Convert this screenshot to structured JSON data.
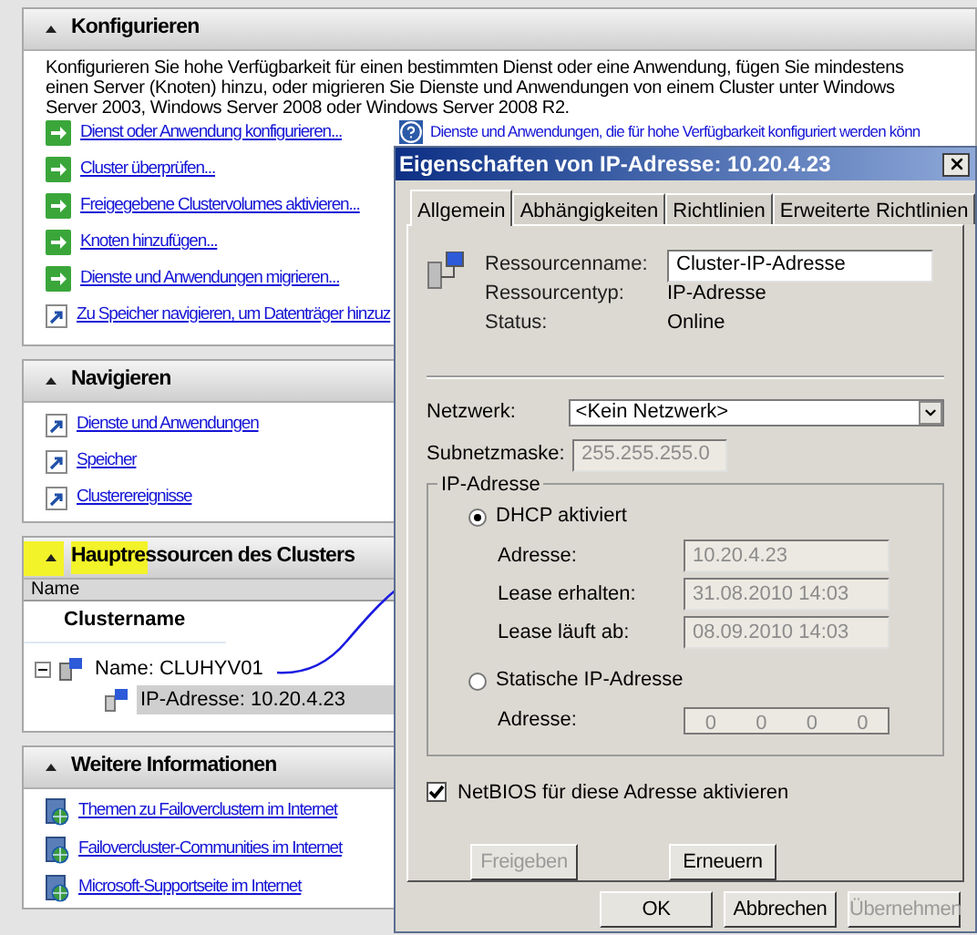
{
  "configure": {
    "title": "Konfigurieren",
    "expanded": true,
    "description": "Konfigurieren Sie hohe Verfügbarkeit für einen bestimmten Dienst oder eine Anwendung, fügen Sie mindestens einen Server (Knoten) hinzu, oder migrieren Sie Dienste und Anwendungen von einem Cluster unter Windows Server 2003, Windows Server 2008 oder Windows Server 2008 R2.",
    "links": [
      {
        "text": "Dienst oder Anwendung konfigurieren...",
        "kind": "wizard"
      },
      {
        "text": "Cluster überprüfen...",
        "kind": "wizard"
      },
      {
        "text": "Freigegebene Clustervolumes aktivieren...",
        "kind": "wizard"
      },
      {
        "text": "Knoten hinzufügen...",
        "kind": "wizard"
      },
      {
        "text": "Dienste und Anwendungen migrieren...",
        "kind": "wizard"
      },
      {
        "text": "Zu Speicher navigieren, um Datenträger hinzuz",
        "kind": "shortcut"
      }
    ],
    "help_link": "Dienste und Anwendungen, die für hohe Verfügbarkeit konfiguriert werden könn"
  },
  "navigate": {
    "title": "Navigieren",
    "expanded": true,
    "links": [
      {
        "text": "Dienste und Anwendungen",
        "kind": "shortcut"
      },
      {
        "text": "Speicher",
        "kind": "shortcut"
      },
      {
        "text": "Clusterereignisse",
        "kind": "shortcut"
      }
    ]
  },
  "resources": {
    "title": "Hauptressourcen des Clusters",
    "expanded": true,
    "column": "Name",
    "group": "Clustername",
    "tree": [
      {
        "label": "Name: CLUHYV01",
        "expanded": true,
        "selected": false,
        "children": [
          {
            "label": "IP-Adresse: 10.20.4.23",
            "selected": true
          }
        ]
      }
    ]
  },
  "more_info": {
    "title": "Weitere Informationen",
    "expanded": true,
    "links": [
      {
        "text": "Themen zu Failoverclustern im Internet",
        "kind": "web"
      },
      {
        "text": "Failovercluster-Communities im Internet",
        "kind": "web"
      },
      {
        "text": "Microsoft-Supportseite im Internet",
        "kind": "web"
      }
    ]
  },
  "dialog": {
    "title": "Eigenschaften von IP-Adresse: 10.20.4.23",
    "tabs": [
      {
        "label": "Allgemein",
        "selected": true
      },
      {
        "label": "Abhängigkeiten",
        "selected": false
      },
      {
        "label": "Richtlinien",
        "selected": false
      },
      {
        "label": "Erweiterte Richtlinien",
        "selected": false
      }
    ],
    "info": [
      {
        "label": "Ressourcenname:",
        "value": "Cluster-IP-Adresse",
        "kind": "input"
      },
      {
        "label": "Ressourcentyp:",
        "value": "IP-Adresse",
        "kind": "text"
      },
      {
        "label": "Status:",
        "value": "Online",
        "kind": "text"
      }
    ],
    "network": {
      "label": "Netzwerk:",
      "value": "<Kein Netzwerk>"
    },
    "subnet": {
      "label": "Subnetzmaske:",
      "value": "255.255.255.0",
      "disabled": true
    },
    "ip_group": {
      "title": "IP-Adresse",
      "options": [
        {
          "label": "DHCP aktiviert",
          "selected": true,
          "fields": [
            {
              "label": "Adresse:",
              "value": "10.20.4.23",
              "kind": "text"
            },
            {
              "label": "Lease erhalten:",
              "value": "31.08.2010 14:03",
              "kind": "text"
            },
            {
              "label": "Lease läuft ab:",
              "value": "08.09.2010 14:03",
              "kind": "text"
            }
          ]
        },
        {
          "label": "Statische IP-Adresse",
          "selected": false,
          "fields": [
            {
              "label": "Adresse:",
              "octets": [
                "0",
                "0",
                "0",
                "0"
              ],
              "kind": "ip"
            }
          ]
        }
      ]
    },
    "netbios": {
      "label": "NetBIOS für diese Adresse aktivieren",
      "checked": true
    },
    "actions": [
      {
        "label": "Freigeben",
        "disabled": true
      },
      {
        "label": "Erneuern",
        "disabled": false
      }
    ],
    "buttons": [
      {
        "label": "OK",
        "disabled": false
      },
      {
        "label": "Abbrechen",
        "disabled": false
      },
      {
        "label": "Übernehmen",
        "disabled": true
      }
    ]
  }
}
